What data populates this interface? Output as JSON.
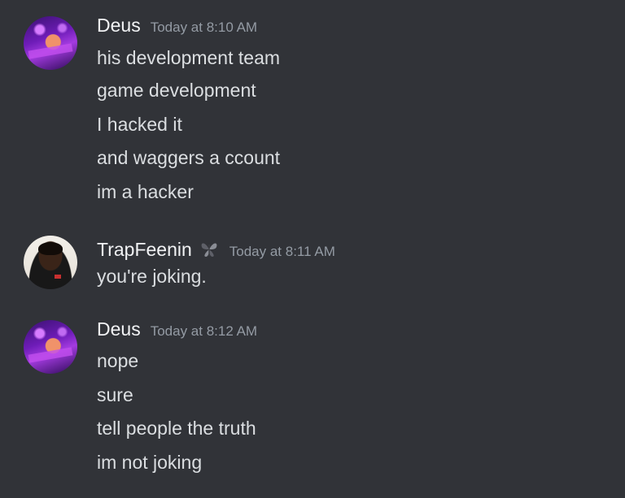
{
  "messages": [
    {
      "author": "Deus",
      "timestamp": "Today at 8:10 AM",
      "lines": [
        "his development team",
        "game development",
        "I hacked it",
        "and waggers a ccount",
        "im a hacker"
      ]
    },
    {
      "author": "TrapFeenin",
      "timestamp": "Today at 8:11 AM",
      "badge_icon": "butterfly-icon",
      "lines": [
        "you're joking."
      ]
    },
    {
      "author": "Deus",
      "timestamp": "Today at 8:12 AM",
      "lines": [
        "nope",
        "sure",
        "tell people the truth",
        "im not joking"
      ]
    }
  ],
  "colors": {
    "background": "#313338",
    "username": "#f2f3f5",
    "timestamp": "#949ba4",
    "message_text": "#dbdee1"
  }
}
